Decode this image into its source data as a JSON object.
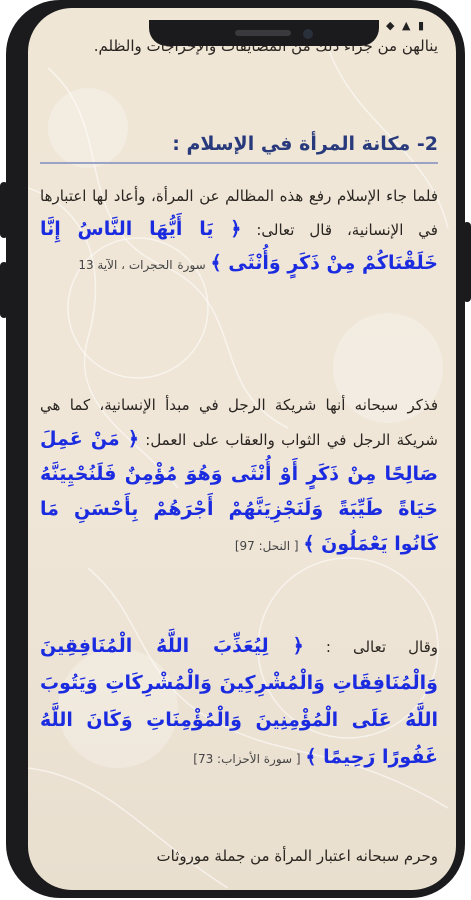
{
  "status_bar": {
    "time": "",
    "icons": "◆ ▲ ▮"
  },
  "article": {
    "top_paragraph": "ينالهن من جراء ذلك من المضايقات والإحراجات والظلم.",
    "section_heading": "2- مكانة المرأة في الإسلام :",
    "para1_lead": "فلما جاء الإسلام رفع هذه المظالم عن المرأة، وأعاد لها اعتبارها في الإنسانية، قال تعالى:",
    "verse1": "﴿ يَا أَيُّهَا النَّاسُ إِنَّا خَلَقْنَاكُمْ مِنْ ذَكَرٍ وَأُنْثَى ﴾",
    "verse1_ref_label": "سورة",
    "verse1_ref": "الحجرات ، الآية 13",
    "para2_lead": "فذكر سبحانه أنها شريكة الرجل في مبدأ الإنسانية، كما هي شريكة الرجل في الثواب والعقاب على العمل:",
    "verse2": "﴿ مَنْ عَمِلَ صَالِحًا مِنْ ذَكَرٍ أَوْ أُنْثَى وَهُوَ مُؤْمِنٌ فَلَنُحْيِيَنَّهُ حَيَاةً طَيِّبَةً وَلَنَجْزِيَنَّهُمْ أَجْرَهُمْ بِأَحْسَنِ مَا كَانُوا يَعْمَلُونَ ﴾",
    "verse2_ref": "[ النحل: 97]",
    "para3_lead": "وقال تعالى :",
    "verse3": "﴿ لِيُعَذِّبَ اللَّهُ الْمُنَافِقِينَ وَالْمُنَافِقَاتِ وَالْمُشْرِكِينَ وَالْمُشْرِكَاتِ وَيَتُوبَ اللَّهُ عَلَى الْمُؤْمِنِينَ وَالْمُؤْمِنَاتِ وَكَانَ اللَّهُ غَفُورًا رَحِيمًا ﴾",
    "verse3_ref": "[ سورة الأحزاب: 73]",
    "bottom_paragraph": "وحرم سبحانه اعتبار المرأة من جملة موروثات"
  }
}
